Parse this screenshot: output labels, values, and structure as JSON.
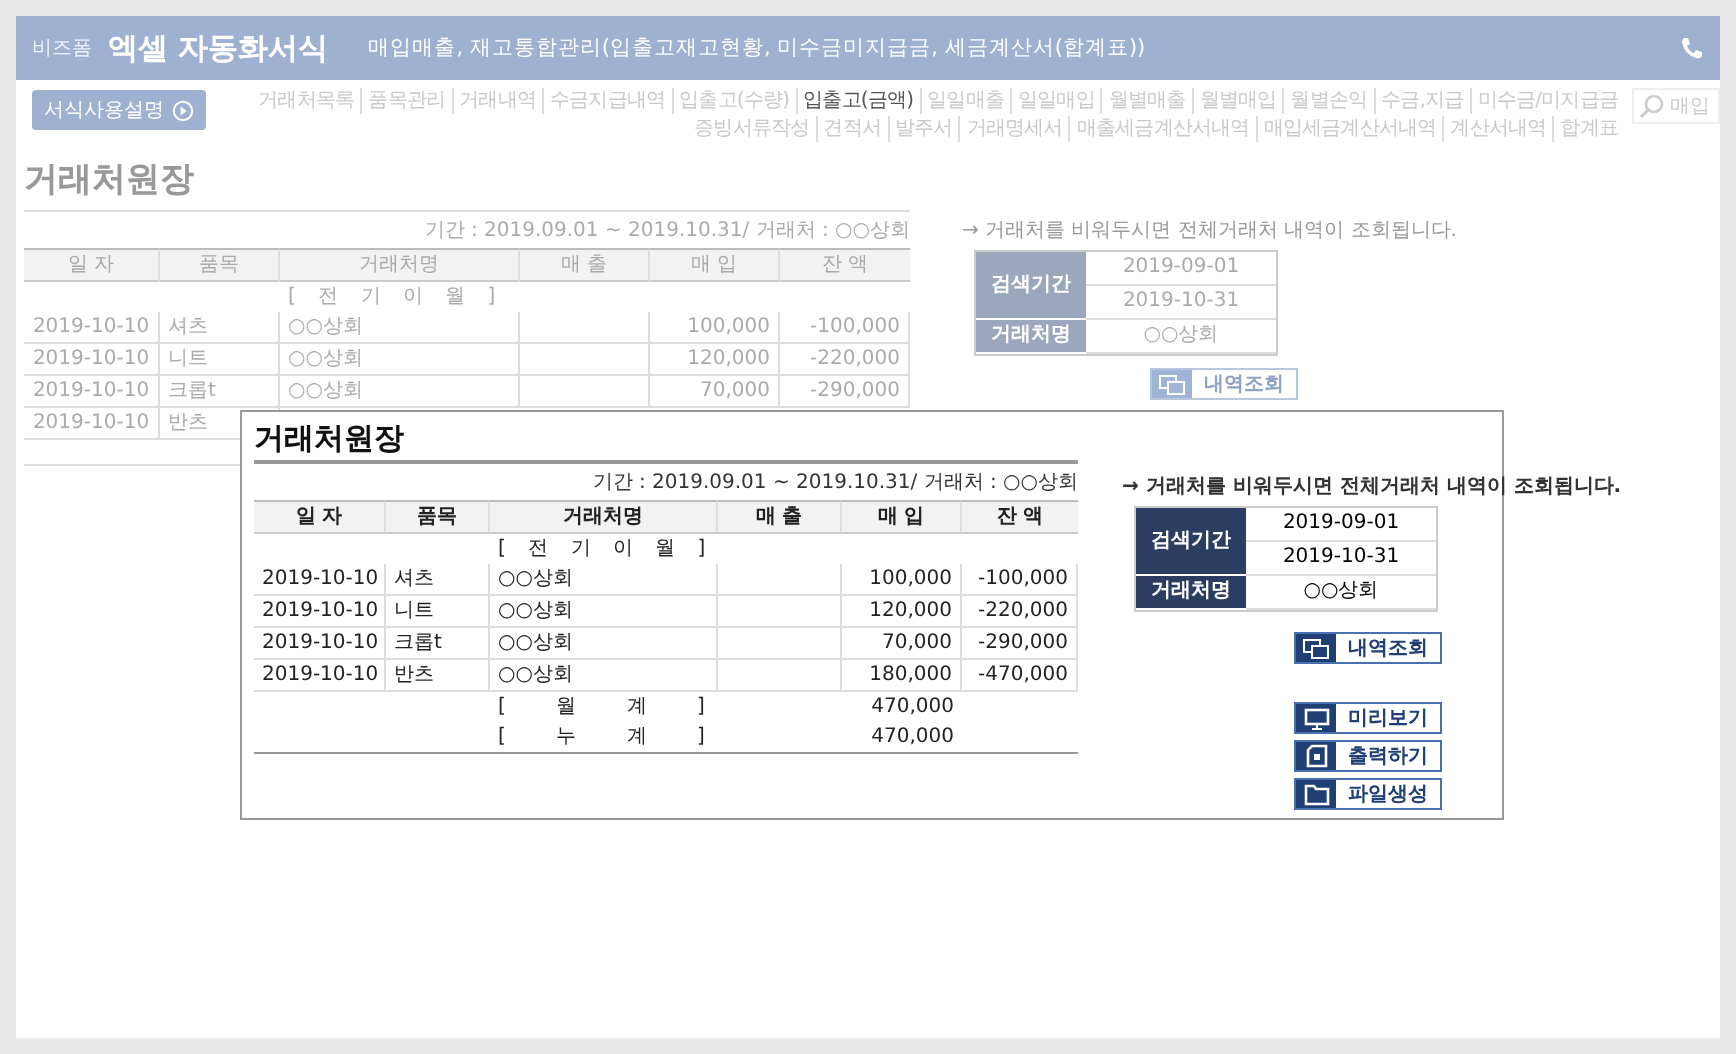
{
  "header": {
    "brand": "비즈폼",
    "title": "엑셀 자동화서식",
    "subtitle": "매입매출, 재고통합관리(입출고재고현황, 미수금미지급금, 세금계산서(합계표))"
  },
  "guide_button": "서식사용설명",
  "menu_rows": [
    [
      {
        "label": "거래처목록",
        "selected": false
      },
      {
        "label": "품목관리",
        "selected": false
      },
      {
        "label": "거래내역",
        "selected": false
      },
      {
        "label": "수금지급내역",
        "selected": false
      },
      {
        "label": "입출고(수량)",
        "selected": false
      },
      {
        "label": "입출고(금액)",
        "selected": true
      },
      {
        "label": "일일매출",
        "selected": false
      },
      {
        "label": "일일매입",
        "selected": false
      },
      {
        "label": "월별매출",
        "selected": false
      },
      {
        "label": "월별매입",
        "selected": false
      },
      {
        "label": "월별손익",
        "selected": false
      },
      {
        "label": "수금,지급",
        "selected": false
      },
      {
        "label": "미수금/미지급금",
        "selected": false
      }
    ],
    [
      {
        "label": "증빙서류작성",
        "selected": false
      },
      {
        "label": "견적서",
        "selected": false
      },
      {
        "label": "발주서",
        "selected": false
      },
      {
        "label": "거래명세서",
        "selected": false
      },
      {
        "label": "매출세금계산서내역",
        "selected": false
      },
      {
        "label": "매입세금계산서내역",
        "selected": false
      },
      {
        "label": "계산서내역",
        "selected": false
      },
      {
        "label": "합계표",
        "selected": false
      }
    ]
  ],
  "search": {
    "placeholder": "매입"
  },
  "background_ledger": {
    "title": "거래처원장",
    "period": "기간 : 2019.09.01 ~ 2019.10.31/ 거래처 : ○○상회",
    "columns": [
      "일 자",
      "품목",
      "거래처명",
      "매 출",
      "매 입",
      "잔 액"
    ],
    "carryover": "[ 전 기 이 월 ]",
    "rows": [
      {
        "date": "2019-10-10",
        "item": "셔츠",
        "vendor": "○○상회",
        "sales": "",
        "purchase": "100,000",
        "balance": "-100,000"
      },
      {
        "date": "2019-10-10",
        "item": "니트",
        "vendor": "○○상회",
        "sales": "",
        "purchase": "120,000",
        "balance": "-220,000"
      },
      {
        "date": "2019-10-10",
        "item": "크롭t",
        "vendor": "○○상회",
        "sales": "",
        "purchase": "70,000",
        "balance": "-290,000"
      },
      {
        "date": "2019-10-10",
        "item": "반츠"
      }
    ],
    "note": "→ 거래처를 비워두시면 전체거래처 내역이 조회됩니다.",
    "search_form": {
      "period_label": "검색기간",
      "period_from": "2019-09-01",
      "period_to": "2019-10-31",
      "vendor_label": "거래처명",
      "vendor": "○○상회"
    },
    "buttons": [
      {
        "kind": "query",
        "label": "내역조회"
      }
    ]
  },
  "ledger": {
    "title": "거래처원장",
    "period": "기간 : 2019.09.01 ~ 2019.10.31/ 거래처 : ○○상회",
    "columns": [
      "일 자",
      "품목",
      "거래처명",
      "매 출",
      "매 입",
      "잔 액"
    ],
    "carryover": "[ 전 기 이 월 ]",
    "rows": [
      {
        "date": "2019-10-10",
        "item": "셔츠",
        "vendor": "○○상회",
        "sales": "",
        "purchase": "100,000",
        "balance": "-100,000"
      },
      {
        "date": "2019-10-10",
        "item": "니트",
        "vendor": "○○상회",
        "sales": "",
        "purchase": "120,000",
        "balance": "-220,000"
      },
      {
        "date": "2019-10-10",
        "item": "크롭t",
        "vendor": "○○상회",
        "sales": "",
        "purchase": "70,000",
        "balance": "-290,000"
      },
      {
        "date": "2019-10-10",
        "item": "반츠",
        "vendor": "○○상회",
        "sales": "",
        "purchase": "180,000",
        "balance": "-470,000"
      }
    ],
    "totals": [
      {
        "label": "[ 월 계 ]",
        "purchase": "470,000"
      },
      {
        "label": "[ 누 계 ]",
        "purchase": "470,000"
      }
    ],
    "note": "→ 거래처를 비워두시면 전체거래처 내역이 조회됩니다.",
    "search_form": {
      "period_label": "검색기간",
      "period_from": "2019-09-01",
      "period_to": "2019-10-31",
      "vendor_label": "거래처명",
      "vendor": "○○상회"
    },
    "buttons": [
      {
        "kind": "query",
        "label": "내역조회"
      },
      {
        "kind": "preview",
        "label": "미리보기"
      },
      {
        "kind": "print",
        "label": "출력하기"
      },
      {
        "kind": "file",
        "label": "파일생성"
      }
    ]
  }
}
